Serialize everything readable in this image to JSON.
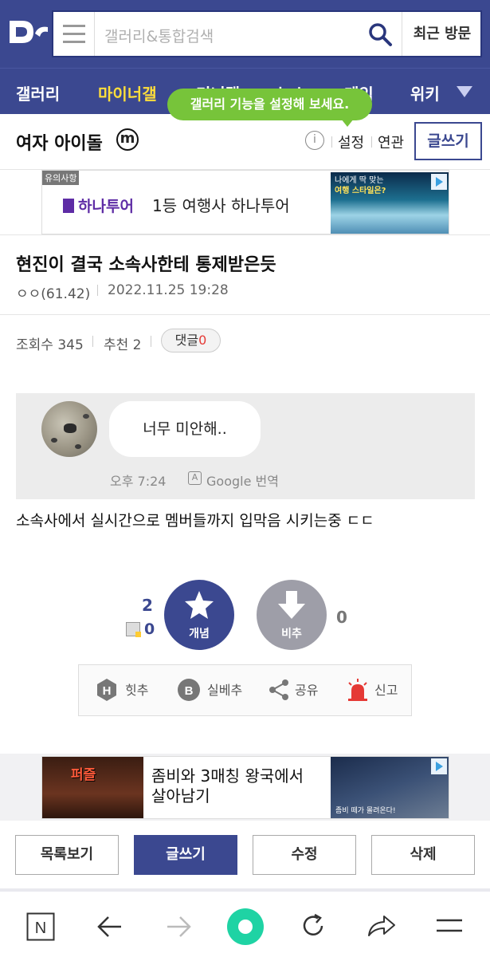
{
  "header": {
    "logo_icon": "dc-logo",
    "search_placeholder": "갤러리&통합검색",
    "recent_label": "최근 방문"
  },
  "nav": {
    "items": [
      "갤러리",
      "마이너갤",
      "미니갤",
      "뉴스",
      "게임",
      "위키"
    ],
    "active": "마이너갤",
    "tooltip": "갤러리 기능을 설정해 보세요."
  },
  "gallery": {
    "title": "여자 아이돌",
    "badge": "m",
    "settings_label": "설정",
    "related_label": "연관",
    "write_label": "글쓰기"
  },
  "ad_top": {
    "notice_label": "유의사항",
    "brand": "하나투어",
    "text": "1등 여행사 하나투어",
    "image_text_1": "나에게 딱 맞는",
    "image_text_2": "여행 스타일은?"
  },
  "post": {
    "title": "현진이 결국 소속사한테 통제받은듯",
    "author": "ㅇㅇ(61.42)",
    "date": "2022.11.25 19:28",
    "views": "조회수 345",
    "recommend": "추천 2",
    "comment_label": "댓글",
    "comment_count": "0",
    "chat_bubble": "너무 미안해..",
    "chat_time": "오후 7:24",
    "translate_label": "Google 번역",
    "body": "소속사에서 실시간으로 멤버들까지 입막음 시키는중 ㄷㄷ"
  },
  "votes": {
    "up_count": "2",
    "fixed_count": "0",
    "up_label": "개념",
    "down_label": "비추",
    "down_count": "0"
  },
  "actions": {
    "hit": "힛추",
    "best": "실베추",
    "share": "공유",
    "report": "신고"
  },
  "ad_bottom": {
    "game_logo": "퍼즐",
    "line1": "좀비와 3매칭 왕국에서",
    "line2": "살아남기",
    "image_caption": "좀비 떼가 몰려온다!"
  },
  "bottom_buttons": {
    "list": "목록보기",
    "write": "글쓰기",
    "edit": "수정",
    "delete": "삭제"
  },
  "colors": {
    "brand": "#3b4890",
    "active_tab": "#ffde3a",
    "tooltip": "#77c43a",
    "alert": "#e53935"
  }
}
